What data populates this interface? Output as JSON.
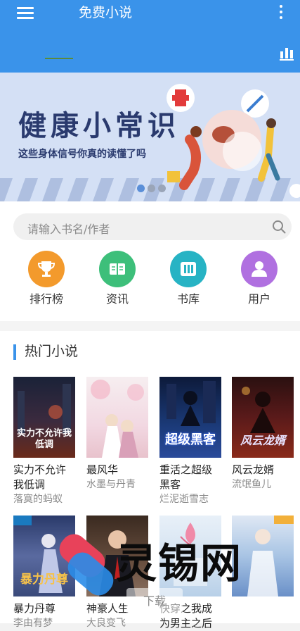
{
  "header": {
    "title": "免费小说",
    "menu_icon": "menu-icon",
    "more_icon": "more-vertical-icon",
    "stats_icon": "bar-chart-icon"
  },
  "banner": {
    "title": "健康小常识",
    "subtitle": "这些身体信号你真的读懂了吗",
    "dots_total": 3,
    "dots_active": 1
  },
  "search": {
    "placeholder": "请输入书名/作者"
  },
  "quick_links": [
    {
      "label": "排行榜",
      "icon": "trophy-icon",
      "color": "#f39a2c"
    },
    {
      "label": "资讯",
      "icon": "news-icon",
      "color": "#3dbf7a"
    },
    {
      "label": "书库",
      "icon": "books-icon",
      "color": "#27b3c4"
    },
    {
      "label": "用户",
      "icon": "user-icon",
      "color": "#b070e0"
    }
  ],
  "section": {
    "title": "热门小说"
  },
  "books": [
    {
      "name": "实力不允许我低调",
      "author": "落寞的蚂蚁",
      "cover_text": "实力不允许我低调"
    },
    {
      "name": "最风华",
      "author": "水墨与丹青",
      "cover_text": ""
    },
    {
      "name": "重活之超级黑客",
      "author": "烂泥逝雪志",
      "cover_text": "超级黑客"
    },
    {
      "name": "风云龙婿",
      "author": "流氓鱼儿",
      "cover_text": "风云龙婿"
    },
    {
      "name": "暴力丹尊",
      "author": "李由有梦",
      "cover_text": "暴力丹尊"
    },
    {
      "name": "神豪人生",
      "author": "大良变飞",
      "cover_text": ""
    },
    {
      "name": "快穿之我成为男主之后",
      "author": "",
      "cover_text": ""
    },
    {
      "name": "",
      "author": "",
      "cover_text": ""
    }
  ],
  "watermark": {
    "text": "灵锡网",
    "download": "下载"
  }
}
